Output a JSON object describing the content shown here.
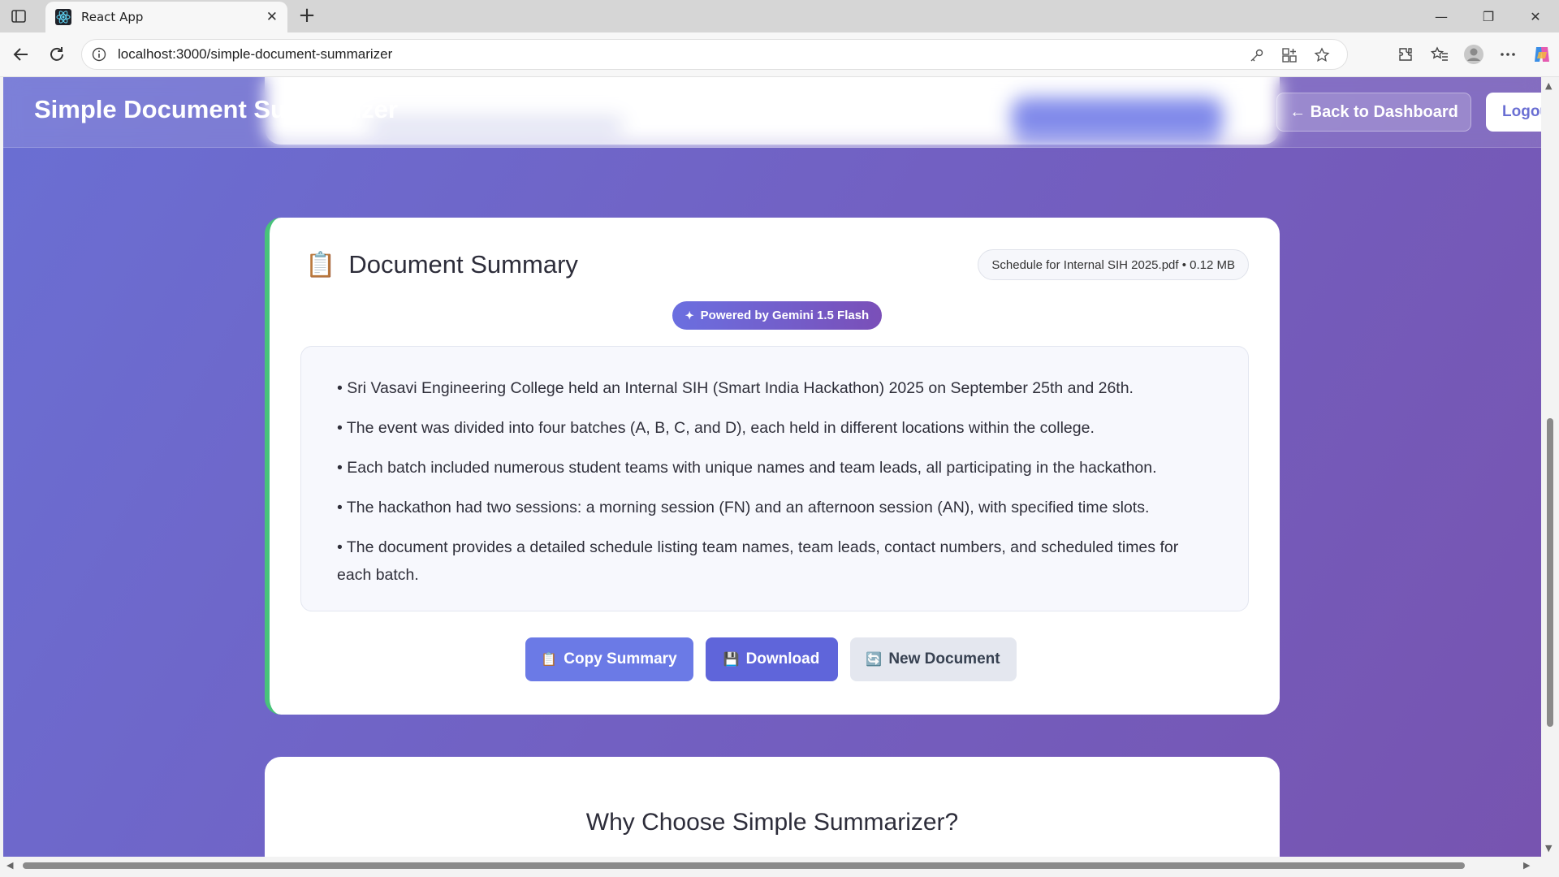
{
  "browser": {
    "tab_title": "React App",
    "url": "localhost:3000/simple-document-summarizer"
  },
  "header": {
    "title": "Simple Document Summarizer",
    "back_label": "← Back to Dashboard",
    "logout_label": "Logout"
  },
  "summary": {
    "icon": "📋",
    "title": "Document Summary",
    "file_info": "Schedule for Internal SIH 2025.pdf • 0.12 MB",
    "badge": "Powered by Gemini 1.5 Flash",
    "badge_icon": "✦",
    "points": [
      "• Sri Vasavi Engineering College held an Internal SIH (Smart India Hackathon) 2025 on September 25th and 26th.",
      "• The event was divided into four batches (A, B, C, and D), each held in different locations within the college.",
      "• Each batch included numerous student teams with unique names and team leads, all participating in the hackathon.",
      "• The hackathon had two sessions: a morning session (FN) and an afternoon session (AN), with specified time slots.",
      "• The document provides a detailed schedule listing team names, team leads, contact numbers, and scheduled times for each batch."
    ],
    "buttons": {
      "copy": "Copy Summary",
      "copy_icon": "📋",
      "download": "Download",
      "download_icon": "💾",
      "new_doc": "New Document",
      "new_doc_icon": "🔄"
    }
  },
  "why": {
    "title": "Why Choose Simple Summarizer?"
  },
  "colors": {
    "accent": "#6b7ae6",
    "success_border": "#48c37a"
  }
}
